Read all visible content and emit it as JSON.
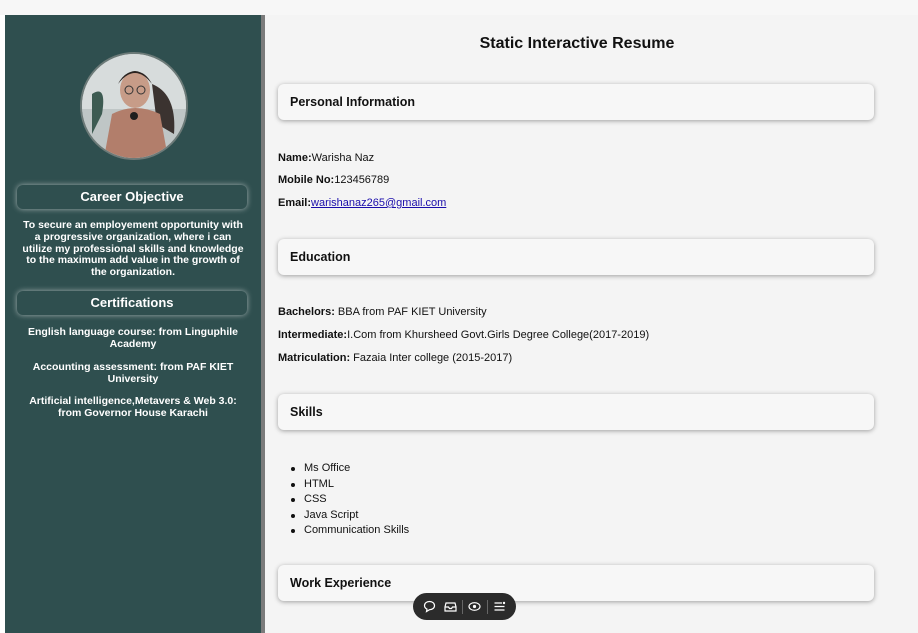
{
  "sidebar": {
    "career_heading": "Career Objective",
    "career_text": "To secure an employement opportunity with a progressive organization, where i can utilize my professional skills and knowledge to the maximum add value in the growth of the organization.",
    "cert_heading": "Certifications",
    "certifications": [
      {
        "title": "English language course:",
        "detail": " from Linguphile Academy"
      },
      {
        "title": "Accounting assessment:",
        "detail": " from PAF KIET University"
      },
      {
        "title": "Artificial intelligence,Metavers & Web 3.0:",
        "detail": " from Governor House Karachi"
      }
    ]
  },
  "main": {
    "title": "Static Interactive Resume",
    "sections": {
      "personal": "Personal Information",
      "education": "Education",
      "skills": "Skills",
      "work": "Work Experience"
    },
    "personal": {
      "name_label": "Name:",
      "name_value": "Warisha Naz",
      "mobile_label": "Mobile No:",
      "mobile_value": "123456789",
      "email_label": "Email:",
      "email_value": "warishanaz265@gmail.com"
    },
    "education": [
      {
        "label": "Bachelors:",
        "value": " BBA from PAF KIET University"
      },
      {
        "label": "Intermediate:",
        "value": "I.Com from Khursheed Govt.Girls Degree College(2017-2019)"
      },
      {
        "label": "Matriculation:",
        "value": " Fazaia Inter college (2015-2017)"
      }
    ],
    "skills": [
      "Ms Office",
      "HTML",
      "CSS",
      "Java Script",
      "Communication Skills"
    ]
  },
  "toolbar": {
    "icons": [
      "comment-icon",
      "inbox-icon",
      "eye-icon",
      "menu-icon"
    ]
  },
  "colors": {
    "sidebar": "#2f4f4f",
    "main_bg": "#f4f4f4",
    "link": "#1a0dab",
    "toolbar": "#2b2b2b"
  }
}
